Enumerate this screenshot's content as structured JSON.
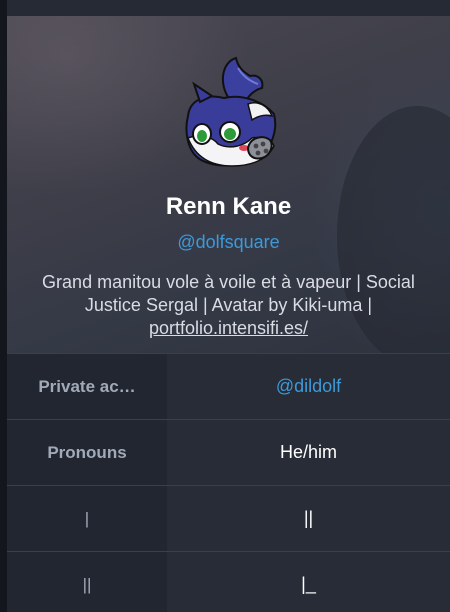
{
  "profile": {
    "display_name": "Renn Kane",
    "handle": "@dolfsquare",
    "bio_text": "Grand manitou vole à voile et à vapeur | Social Justice Sergal | Avatar by Kiki-uma |",
    "bio_link": "portfolio.intensifi.es/",
    "avatar_icon": "wolf-avatar-icon"
  },
  "fields": [
    {
      "name": "Private ac…",
      "value": "@dildolf"
    },
    {
      "name": "Pronouns",
      "value": "He/him"
    },
    {
      "name": "|",
      "value": "||"
    },
    {
      "name": "||",
      "value": "|_"
    }
  ],
  "colors": {
    "accent": "#3d9ad9",
    "card_bg": "#282c37",
    "field_name_bg": "#222630"
  }
}
